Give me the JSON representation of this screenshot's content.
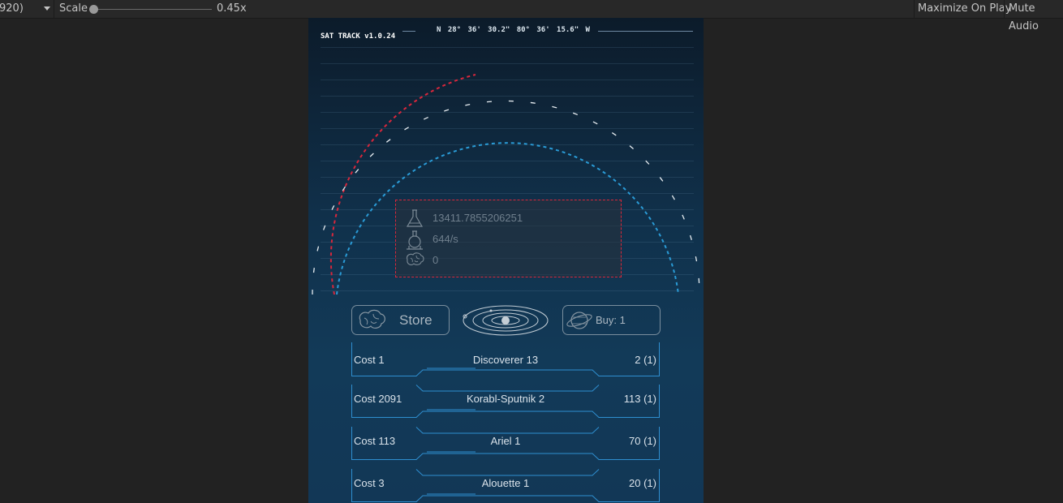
{
  "toolbar": {
    "resolution_label": "920)",
    "scale_label": "Scale",
    "scale_value": "0.45x",
    "scale_level": 0.0,
    "maximize_label": "Maximize On Play",
    "mute_label": "Mute Audio"
  },
  "hud": {
    "version": "SAT TRACK v1.0.24",
    "coordinates": "N 28° 36' 30.2\"  80° 36' 15.6\" W"
  },
  "stats": {
    "science_total": "13411.7855206251",
    "science_rate": "644/s",
    "brain_count": "0",
    "icons": [
      "flask-icon",
      "flask-stand-icon",
      "brain-icon"
    ]
  },
  "buttons": {
    "store_label": "Store",
    "buy_label": "Buy: 1"
  },
  "satellites": [
    {
      "cost": "Cost 1",
      "name": "Discoverer 13",
      "count": "2 (1)"
    },
    {
      "cost": "Cost 2091",
      "name": "Korabl-Sputnik 2",
      "count": "113 (1)"
    },
    {
      "cost": "Cost 113",
      "name": "Ariel 1",
      "count": "70 (1)"
    },
    {
      "cost": "Cost 3",
      "name": "Alouette 1",
      "count": "20 (1)"
    }
  ],
  "colors": {
    "accent_red": "#d8273c",
    "accent_blue": "#2a9bd6",
    "frame_blue": "#2f8fd0"
  }
}
